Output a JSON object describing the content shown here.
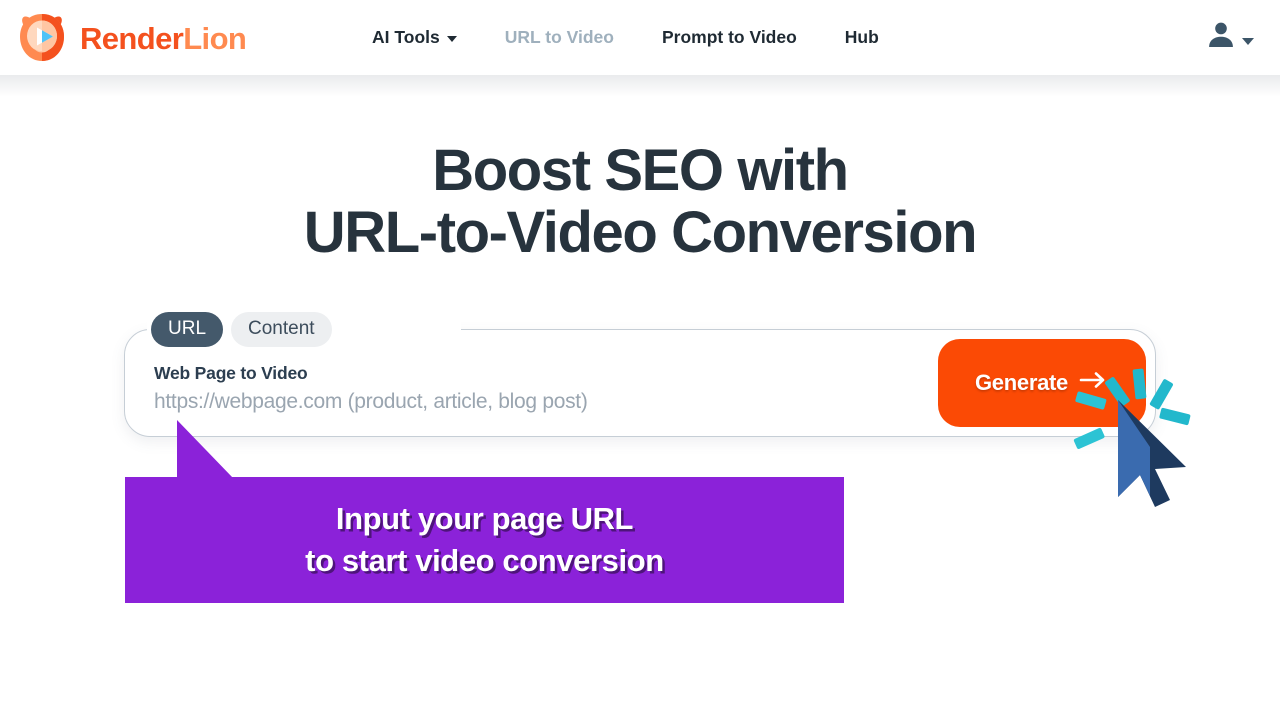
{
  "brand": {
    "name_part1": "Render",
    "name_part2": "Lion",
    "logo_icon": "lion-play-logo",
    "color_primary": "#F4511E",
    "color_secondary": "#FF8A50"
  },
  "header": {
    "nav": [
      {
        "label": "AI Tools",
        "state": "default",
        "has_dropdown": true
      },
      {
        "label": "URL to Video",
        "state": "muted",
        "has_dropdown": false
      },
      {
        "label": "Prompt to Video",
        "state": "default",
        "has_dropdown": false
      },
      {
        "label": "Hub",
        "state": "default",
        "has_dropdown": false
      }
    ],
    "account_icon": "user-account-icon",
    "account_caret_icon": "chevron-down-icon"
  },
  "hero": {
    "headline_line1": "Boost SEO with",
    "headline_line2": "URL-to-Video Conversion",
    "headline_color": "#27333D"
  },
  "input_card": {
    "tabs": [
      {
        "label": "URL",
        "active": true
      },
      {
        "label": "Content",
        "active": false
      }
    ],
    "field_label": "Web Page to Video",
    "field_value": "",
    "field_placeholder": "https://webpage.com (product, article, blog post)",
    "generate_label": "Generate",
    "generate_icon": "arrow-right-icon",
    "generate_color": "#FB4A05",
    "active_tab_color": "#44596B"
  },
  "callout": {
    "line1": "Input your page URL",
    "line2": "to start video conversion",
    "background_color": "#8B22D9",
    "text_color": "#FFFFFF"
  },
  "cursor": {
    "icon": "mouse-pointer-icon",
    "click_burst_icon": "click-burst-rays",
    "arrow_light": "#3A6BAF",
    "arrow_dark": "#1E3A5F",
    "burst_color": "#22B8CC"
  }
}
